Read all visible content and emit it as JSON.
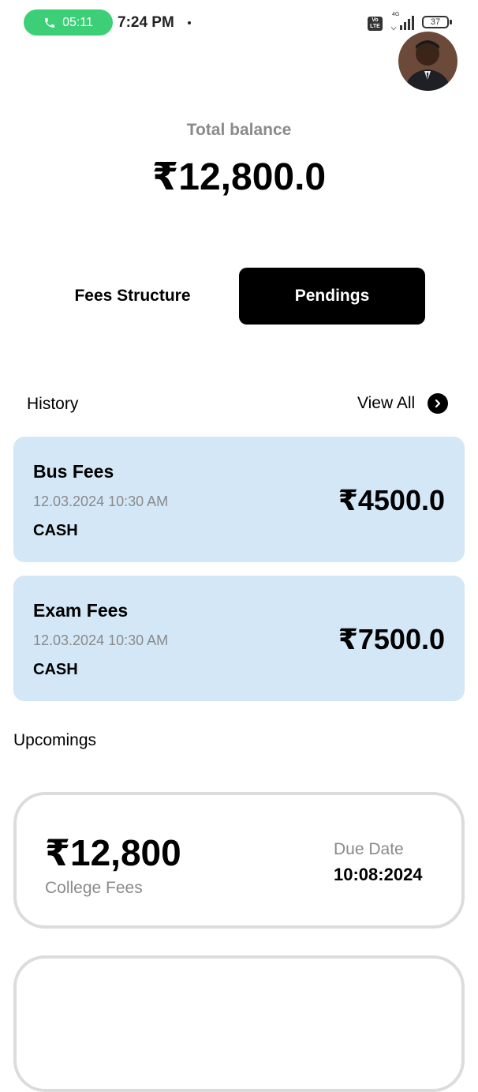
{
  "status_bar": {
    "call_timer": "05:11",
    "time": "7:24 PM",
    "network": "4G",
    "volte": "Vo LTE",
    "battery": "37"
  },
  "balance": {
    "label": "Total balance",
    "amount": "₹12,800.0"
  },
  "tabs": {
    "fees_structure": "Fees Structure",
    "pendings": "Pendings",
    "active": "pendings"
  },
  "history": {
    "title": "History",
    "view_all": "View All",
    "items": [
      {
        "title": "Bus Fees",
        "date": "12.03.2024  10:30 AM",
        "method": "CASH",
        "amount": "₹4500.0"
      },
      {
        "title": "Exam Fees",
        "date": "12.03.2024  10:30 AM",
        "method": "CASH",
        "amount": "₹7500.0"
      }
    ]
  },
  "upcomings": {
    "title": "Upcomings",
    "items": [
      {
        "amount": "₹12,800",
        "name": "College Fees",
        "due_label": "Due Date",
        "due_date": "10:08:2024"
      }
    ]
  },
  "colors": {
    "call_pill": "#3ccf77",
    "card_bg": "#d3e7f6",
    "active_tab": "#000000",
    "muted_text": "#8a8a8a",
    "upcoming_border": "#dcdcdc"
  }
}
